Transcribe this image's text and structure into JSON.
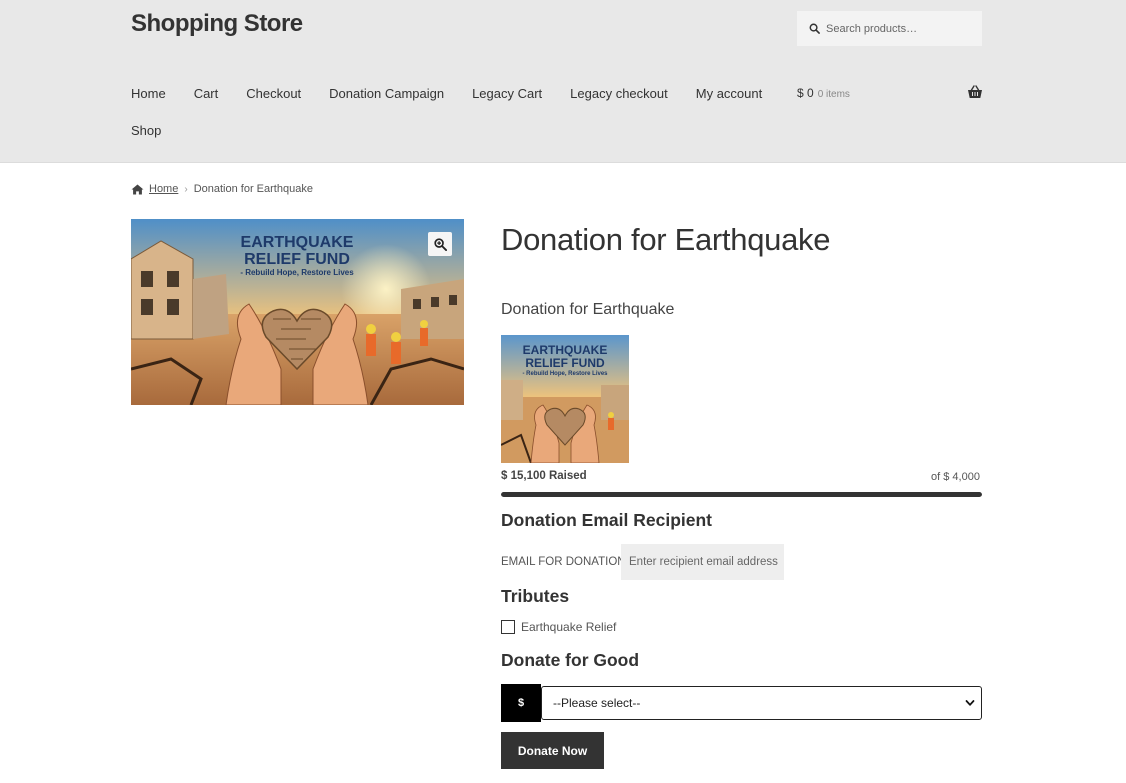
{
  "header": {
    "site_title": "Shopping Store",
    "search_placeholder": "Search products…"
  },
  "nav": {
    "items": [
      "Home",
      "Cart",
      "Checkout",
      "Donation Campaign",
      "Legacy Cart",
      "Legacy checkout",
      "My account"
    ],
    "shop": "Shop"
  },
  "cart": {
    "amount": "$ 0",
    "items": "0 items"
  },
  "breadcrumb": {
    "home": "Home",
    "current": "Donation for Earthquake"
  },
  "product": {
    "title": "Donation for Earthquake",
    "image_text": {
      "line1": "EARTHQUAKE",
      "line2": "RELIEF FUND",
      "line3": "- Rebuild Hope, Restore Lives"
    }
  },
  "campaign": {
    "title": "Donation for Earthquake",
    "raised": "$ 15,100 Raised",
    "goal": "of $ 4,000",
    "progress_fraction": 1.0
  },
  "email_section": {
    "heading": "Donation Email Recipient",
    "label": "EMAIL FOR DONATION",
    "placeholder": "Enter recipient email address"
  },
  "tributes": {
    "heading": "Tributes",
    "option": "Earthquake Relief"
  },
  "donate": {
    "heading": "Donate for Good",
    "currency": "$",
    "select_value": "--Please select--",
    "button": "Donate Now"
  },
  "colors": {
    "header_bg": "#e8e8e8",
    "dark": "#333333",
    "black": "#000000"
  }
}
